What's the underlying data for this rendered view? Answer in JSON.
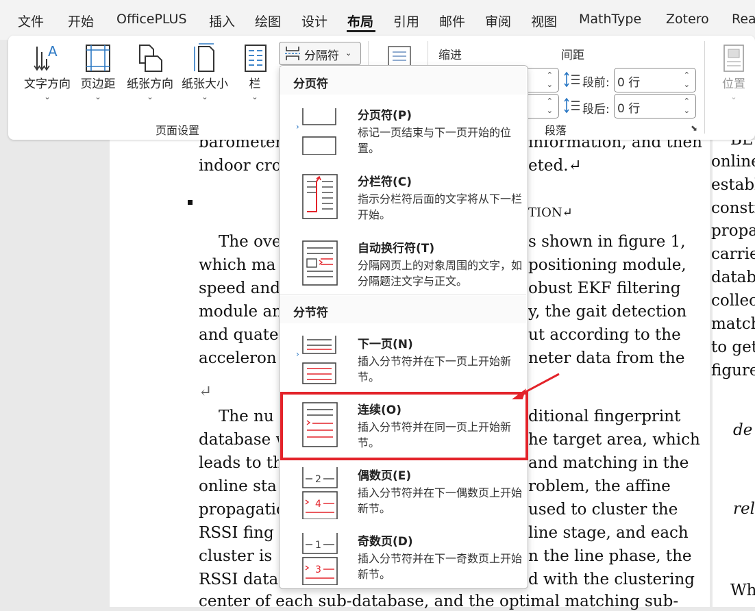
{
  "menu": {
    "tabs": [
      "文件",
      "开始",
      "OfficePLUS",
      "插入",
      "绘图",
      "设计",
      "布局",
      "引用",
      "邮件",
      "审阅",
      "视图",
      "MathType",
      "Zotero",
      "Rea"
    ],
    "active": "布局"
  },
  "ribbon": {
    "page_setup": {
      "text_direction": "文字方向",
      "margins": "页边距",
      "orientation": "纸张方向",
      "size": "纸张大小",
      "columns": "栏",
      "breaks": "分隔符",
      "group_label": "页面设置"
    },
    "paragraph": {
      "indent_label": "缩进",
      "spacing_label": "间距",
      "before_label": "段前:",
      "before_value": "0 行",
      "after_label": "段后:",
      "after_value": "0 行",
      "group_label": "段落"
    },
    "arrange": {
      "position": "位置"
    }
  },
  "dropdown": {
    "page_breaks_header": "分页符",
    "section_breaks_header": "分节符",
    "items": [
      {
        "title": "分页符(P)",
        "desc": "标记一页结束与下一页开始的位置。"
      },
      {
        "title": "分栏符(C)",
        "desc": "指示分栏符后面的文字将从下一栏开始。"
      },
      {
        "title": "自动换行符(T)",
        "desc": "分隔网页上的对象周围的文字，如分隔题注文字与正文。"
      },
      {
        "title": "下一页(N)",
        "desc": "插入分节符并在下一页上开始新节。"
      },
      {
        "title": "连续(O)",
        "desc": "插入分节符并在同一页上开始新节。"
      },
      {
        "title": "偶数页(E)",
        "desc": "插入分节符并在下一偶数页上开始新节。"
      },
      {
        "title": "奇数页(D)",
        "desc": "插入分节符并在下一奇数页上开始新节。"
      }
    ]
  },
  "document": {
    "lines": [
      "barometer",
      "information, and then",
      "indoor cro",
      "eted.↵",
      "TION↵",
      "The ove",
      "s shown in figure 1,",
      "which ma",
      "positioning module,",
      "speed and",
      "obust EKF filtering",
      "module an",
      "y, the gait detection",
      "and quate",
      "ut according to the",
      "acceleron",
      "neter data from the",
      "↵",
      "The nu",
      "ditional fingerprint",
      "database w",
      "he target area, which",
      "leads to th",
      "and matching in the",
      "online sta",
      "roblem, the affine",
      "propagatio",
      "used to cluster the",
      "RSSI fing",
      "line stage, and each",
      "cluster is",
      "n the line phase, the",
      "RSSI data",
      "d with the clustering",
      "center of each sub-database, and the optimal matching sub-"
    ],
    "right_lines": [
      "BL",
      "online",
      "establ",
      "constr",
      "propa",
      "carrie",
      "databa",
      "collec",
      "match",
      "to get",
      "figure",
      "de",
      "rel",
      "Wh"
    ]
  }
}
